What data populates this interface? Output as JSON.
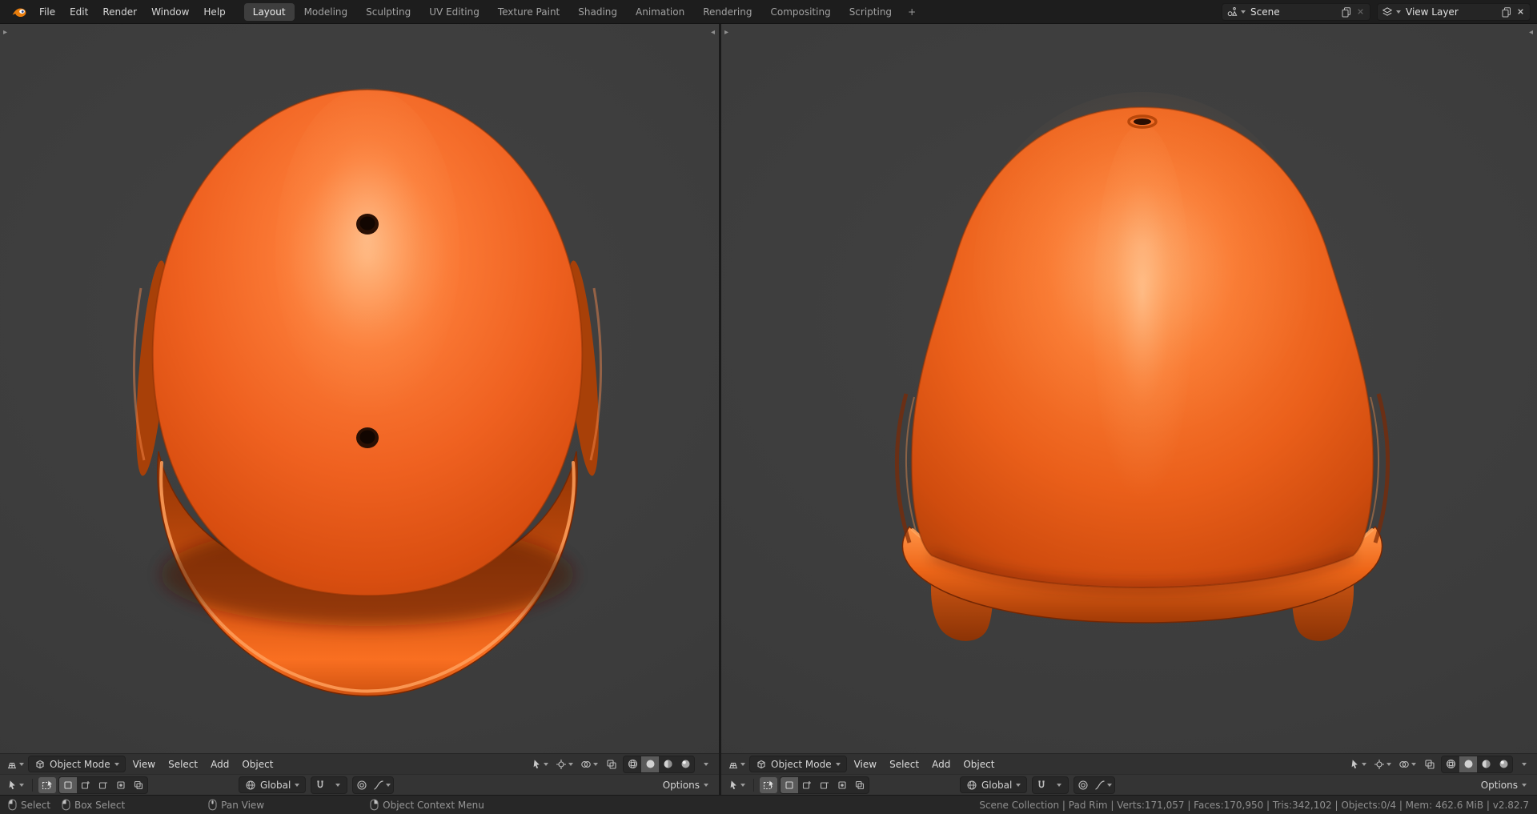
{
  "topbar": {
    "menus": [
      "File",
      "Edit",
      "Render",
      "Window",
      "Help"
    ],
    "workspace_tabs": [
      "Layout",
      "Modeling",
      "Sculpting",
      "UV Editing",
      "Texture Paint",
      "Shading",
      "Animation",
      "Rendering",
      "Compositing",
      "Scripting"
    ],
    "active_tab": "Layout",
    "add_workspace_label": "+",
    "scene_selector": {
      "value": "Scene"
    },
    "view_layer_selector": {
      "value": "View Layer"
    }
  },
  "viewport": {
    "mode_label": "Object Mode",
    "menu_view": "View",
    "menu_select": "Select",
    "menu_add": "Add",
    "menu_object": "Object",
    "orientation_label": "Global",
    "options_label": "Options",
    "left_content": "orange batting helmet - top view",
    "right_content": "orange batting helmet - back view"
  },
  "statusbar": {
    "hint_select": "Select",
    "hint_box_select": "Box Select",
    "hint_pan": "Pan View",
    "hint_context_menu": "Object Context Menu",
    "stats": "Scene Collection | Pad Rim | Verts:171,057 | Faces:170,950 | Tris:342,102 | Objects:0/4 | Mem: 462.6 MiB | v2.82.7"
  },
  "colors": {
    "helmet_base": "#ee5f1d",
    "helmet_highlight": "#ffa466",
    "helmet_shadow": "#a03a06",
    "viewport_background": "#3c3c3c",
    "topbar_background": "#1d1d1d",
    "header_background": "#313131",
    "statusbar_background": "#272727"
  },
  "icon_names": [
    "blender-logo",
    "scene-icon",
    "view-layer-icon",
    "duplicate-icon",
    "close-icon",
    "editor-3d-viewport-icon",
    "object-mode-cube-icon",
    "cursor-icon",
    "gizmo-icon",
    "overlays-icon",
    "xray-icon",
    "shading-wireframe-icon",
    "shading-solid-icon",
    "shading-material-icon",
    "shading-rendered-icon",
    "box-select-tool-icon",
    "orientation-globe-icon",
    "snap-magnet-icon",
    "proportional-circle-icon",
    "falloff-curve-icon",
    "mouse-left-icon",
    "mouse-middle-icon",
    "mouse-right-icon"
  ]
}
